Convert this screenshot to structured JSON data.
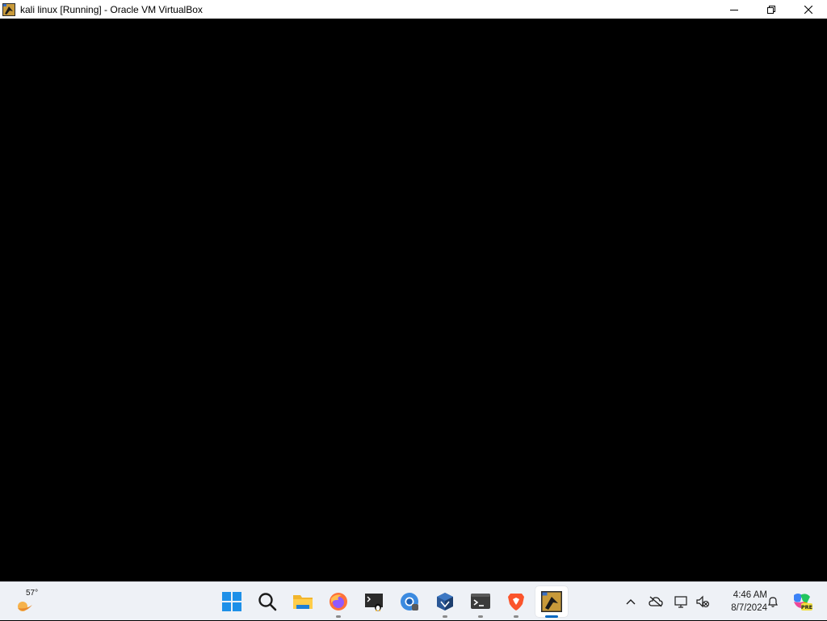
{
  "window": {
    "title": "kali linux [Running] - Oracle VM VirtualBox",
    "controls": {
      "minimize": "minimize-icon",
      "restore": "restore-icon",
      "close": "close-icon"
    }
  },
  "taskbar": {
    "weather": {
      "temperature": "57°",
      "icon": "sun-moon-icon"
    },
    "pinned": [
      {
        "name": "start",
        "icon": "windows-logo-icon",
        "running": false,
        "active": false
      },
      {
        "name": "search",
        "icon": "search-icon",
        "running": false,
        "active": false
      },
      {
        "name": "file-explorer",
        "icon": "folder-icon",
        "running": false,
        "active": false
      },
      {
        "name": "firefox",
        "icon": "firefox-icon",
        "running": true,
        "active": false
      },
      {
        "name": "linux-terminal",
        "icon": "tux-terminal-icon",
        "running": false,
        "active": false
      },
      {
        "name": "chrome-dev",
        "icon": "chrome-icon",
        "running": false,
        "active": false
      },
      {
        "name": "virtualbox",
        "icon": "virtualbox-icon",
        "running": true,
        "active": false
      },
      {
        "name": "terminal",
        "icon": "terminal-icon",
        "running": true,
        "active": false
      },
      {
        "name": "brave",
        "icon": "brave-icon",
        "running": true,
        "active": false
      },
      {
        "name": "kali-vm",
        "icon": "kali-vm-icon",
        "running": true,
        "active": true
      }
    ],
    "tray": {
      "overflow_icon": "chevron-up-icon",
      "cloud_icon": "cloud-off-icon",
      "network_icon": "network-display-icon",
      "volume_icon": "volume-muted-icon",
      "time": "4:46 AM",
      "date": "8/7/2024",
      "notification_icon": "bell-icon",
      "copilot_icon": "copilot-pre-icon",
      "copilot_badge": "PRE"
    }
  },
  "colors": {
    "accent": "#0067c0",
    "taskbar_bg": "#eef1f6",
    "vm_screen": "#000000"
  }
}
